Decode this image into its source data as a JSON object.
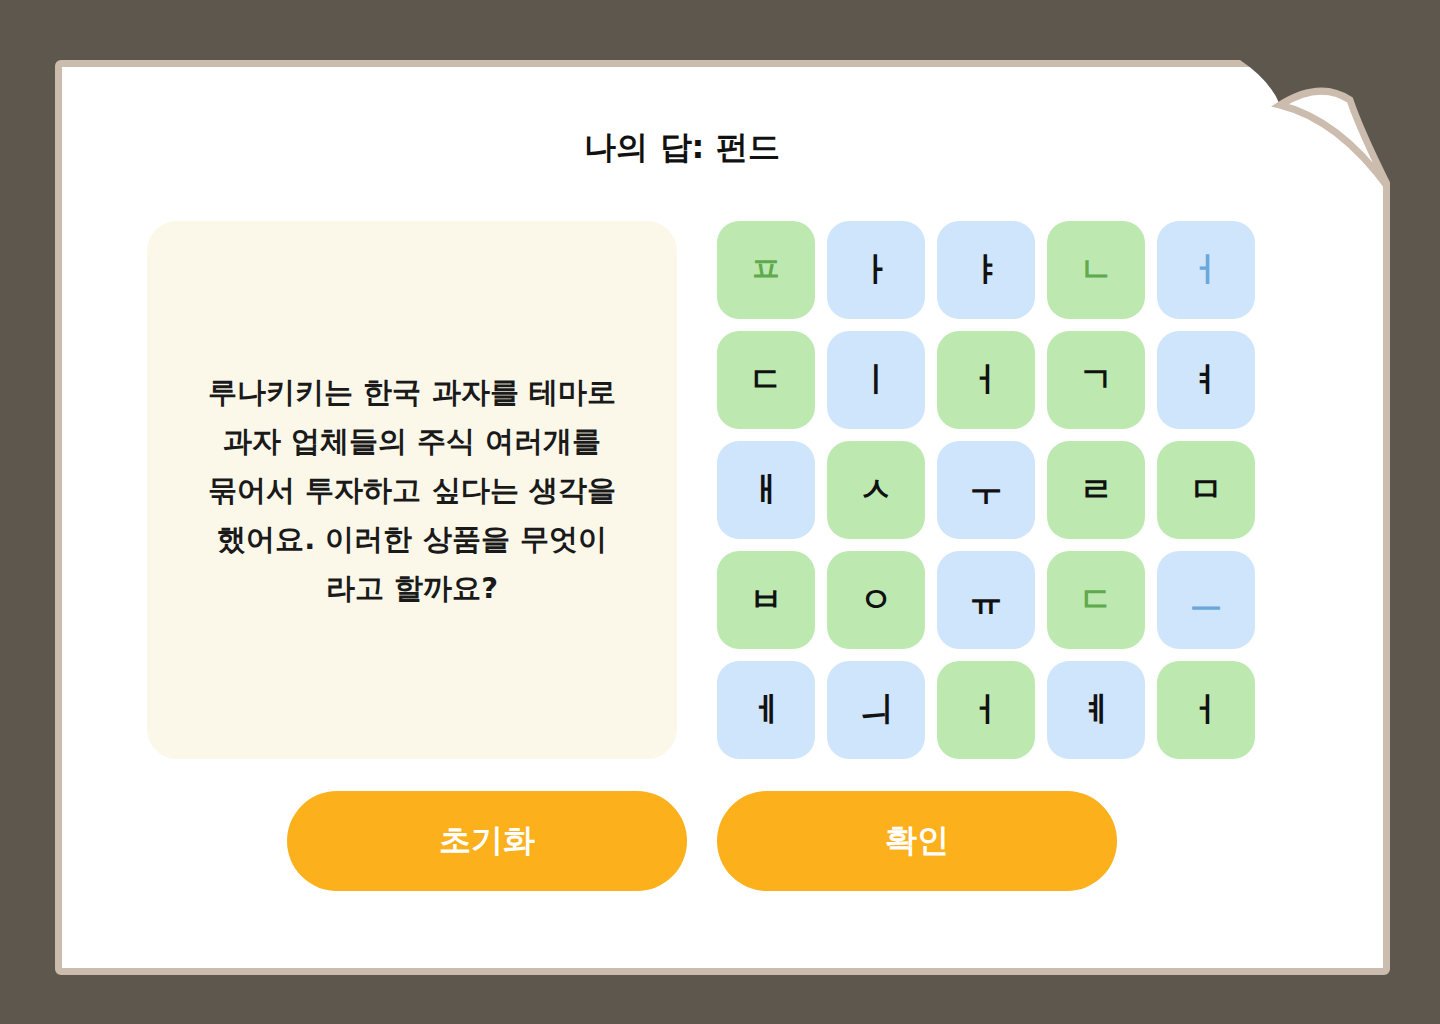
{
  "answer": {
    "label": "나의 답: 펀드"
  },
  "question": {
    "text": "루나키키는 한국 과자를 테마로 과자 업체들의 주식 여러개를 묶어서 투자하고 싶다는 생각을 했어요. 이러한 상품을 무엇이라고 할까요?"
  },
  "tiles": [
    {
      "letter": "ㅍ",
      "color": "#bde9b0",
      "selected": true
    },
    {
      "letter": "ㅏ",
      "color": "#cfe5fb",
      "selected": false
    },
    {
      "letter": "ㅑ",
      "color": "#cfe5fb",
      "selected": false
    },
    {
      "letter": "ㄴ",
      "color": "#bde9b0",
      "selected": true
    },
    {
      "letter": "ㅓ",
      "color": "#cfe5fb",
      "selected": true
    },
    {
      "letter": "ㄷ",
      "color": "#bde9b0",
      "selected": false
    },
    {
      "letter": "ㅣ",
      "color": "#cfe5fb",
      "selected": false
    },
    {
      "letter": "ㅓ",
      "color": "#bde9b0",
      "selected": false
    },
    {
      "letter": "ㄱ",
      "color": "#bde9b0",
      "selected": false
    },
    {
      "letter": "ㅕ",
      "color": "#cfe5fb",
      "selected": false
    },
    {
      "letter": "ㅐ",
      "color": "#cfe5fb",
      "selected": false
    },
    {
      "letter": "ㅅ",
      "color": "#bde9b0",
      "selected": false
    },
    {
      "letter": "ㅜ",
      "color": "#cfe5fb",
      "selected": false
    },
    {
      "letter": "ㄹ",
      "color": "#bde9b0",
      "selected": false
    },
    {
      "letter": "ㅁ",
      "color": "#bde9b0",
      "selected": false
    },
    {
      "letter": "ㅂ",
      "color": "#bde9b0",
      "selected": false
    },
    {
      "letter": "ㅇ",
      "color": "#bde9b0",
      "selected": false
    },
    {
      "letter": "ㅠ",
      "color": "#cfe5fb",
      "selected": false
    },
    {
      "letter": "ㄷ",
      "color": "#bde9b0",
      "selected": true
    },
    {
      "letter": "ㅡ",
      "color": "#cfe5fb",
      "selected": true
    },
    {
      "letter": "ㅔ",
      "color": "#cfe5fb",
      "selected": false
    },
    {
      "letter": "ㅢ",
      "color": "#cfe5fb",
      "selected": false
    },
    {
      "letter": "ㅓ",
      "color": "#bde9b0",
      "selected": false
    },
    {
      "letter": "ㅖ",
      "color": "#cfe5fb",
      "selected": false
    },
    {
      "letter": "ㅓ",
      "color": "#bde9b0",
      "selected": false
    }
  ],
  "buttons": [
    "초기화",
    "확인"
  ]
}
